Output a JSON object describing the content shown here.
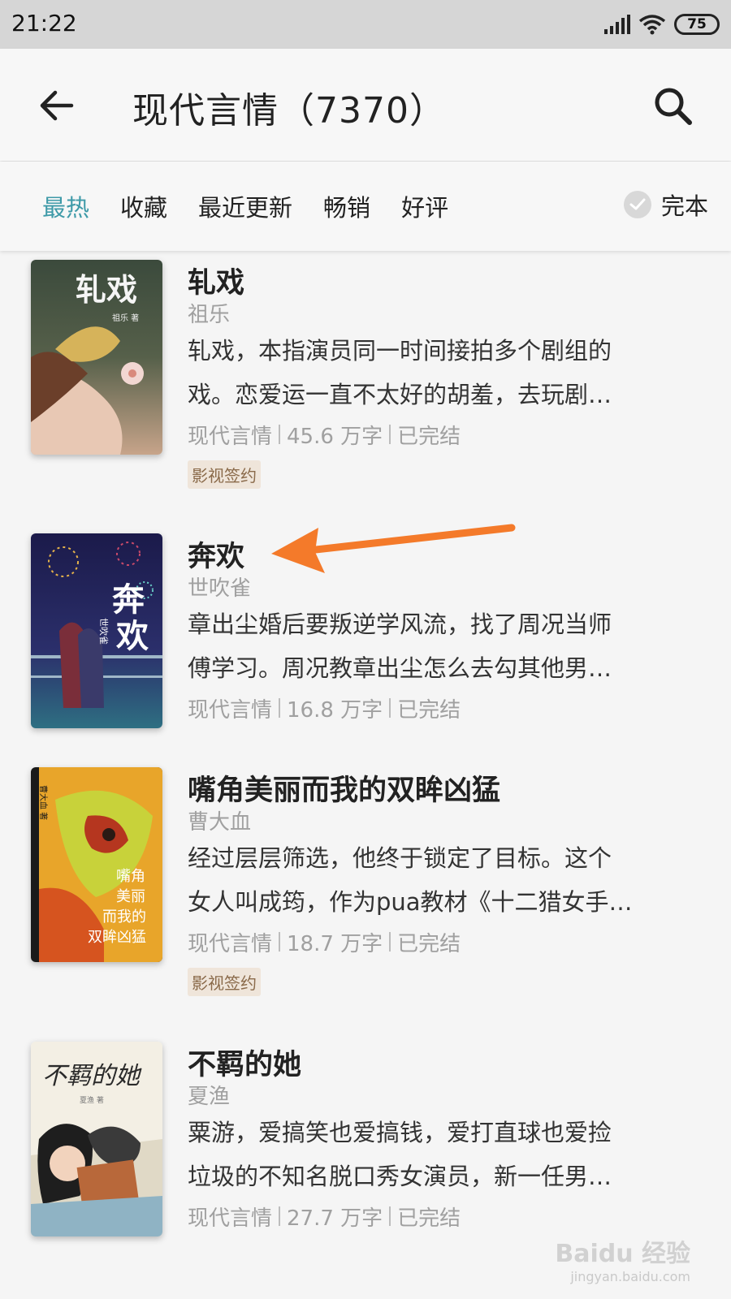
{
  "status_bar": {
    "time": "21:22",
    "battery": "75"
  },
  "header": {
    "title": "现代言情（7370）"
  },
  "filter_tabs": [
    {
      "label": "最热",
      "active": true
    },
    {
      "label": "收藏",
      "active": false
    },
    {
      "label": "最近更新",
      "active": false
    },
    {
      "label": "畅销",
      "active": false
    },
    {
      "label": "好评",
      "active": false
    }
  ],
  "complete_toggle": {
    "label": "完本"
  },
  "books": [
    {
      "title": "轧戏",
      "author": "祖乐",
      "desc_line1": "轧戏，本指演员同一时间接拍多个剧组的",
      "desc_line2": "戏。恋爱运一直不太好的胡羞，去玩剧…",
      "category": "现代言情",
      "words": "45.6 万字",
      "status": "已完结",
      "badge": "影视签约",
      "cover_text": "轧戏",
      "cover_author": "祖乐 著"
    },
    {
      "title": "奔欢",
      "author": "世吹雀",
      "desc_line1": "章出尘婚后要叛逆学风流，找了周况当师",
      "desc_line2": "傅学习。周况教章出尘怎么去勾其他男…",
      "category": "现代言情",
      "words": "16.8 万字",
      "status": "已完结",
      "cover_text_1": "奔",
      "cover_text_2": "欢",
      "cover_author": "世吹雀"
    },
    {
      "title": "嘴角美丽而我的双眸凶猛",
      "author": "曹大血",
      "desc_line1": "经过层层筛选，他终于锁定了目标。这个",
      "desc_line2": "女人叫成筠，作为pua教材《十二猎女手…",
      "category": "现代言情",
      "words": "18.7 万字",
      "status": "已完结",
      "badge": "影视签约",
      "cover_author": "曹大血 著",
      "cover_lines": [
        "嘴角",
        "美丽",
        "而我的",
        "双眸凶猛"
      ]
    },
    {
      "title": "不羁的她",
      "author": "夏渔",
      "desc_line1": "粟游，爱搞笑也爱搞钱，爱打直球也爱捡",
      "desc_line2": "垃圾的不知名脱口秀女演员，新一任男…",
      "category": "现代言情",
      "words": "27.7 万字",
      "status": "已完结",
      "cover_text": "不羁的她",
      "cover_author": "夏渔 著"
    }
  ],
  "watermark": {
    "logo": "Baidu 经验",
    "url": "jingyan.baidu.com"
  },
  "colors": {
    "accent": "#3e9aa8",
    "arrow": "#f47a2a",
    "badge_bg": "#efe5da"
  }
}
